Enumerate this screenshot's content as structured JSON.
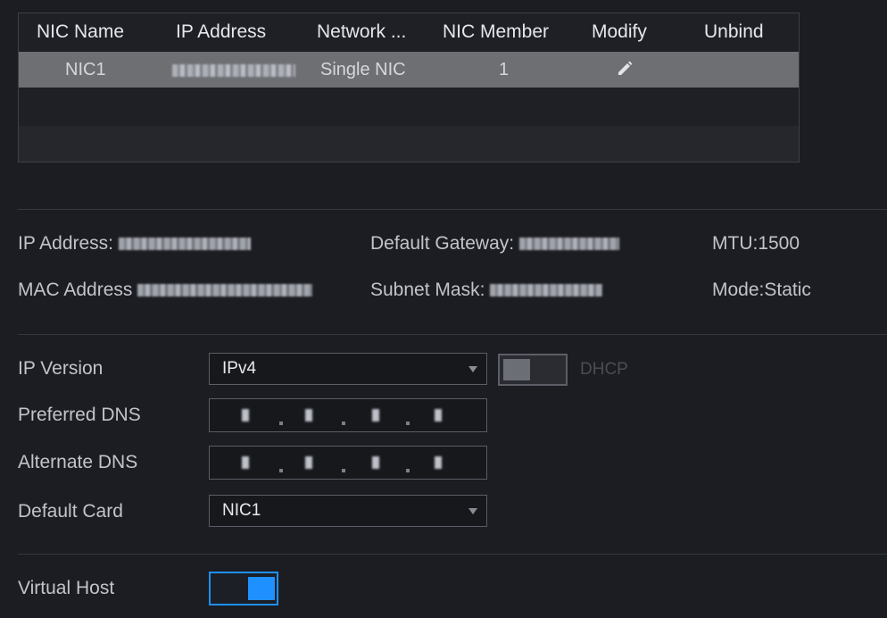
{
  "nic_table": {
    "columns": [
      "NIC Name",
      "IP Address",
      "Network ...",
      "NIC Member",
      "Modify",
      "Unbind"
    ],
    "rows": [
      {
        "nic_name": "NIC1",
        "network_mode": "Single NIC",
        "nic_member": "1"
      }
    ]
  },
  "info": {
    "ip_address_label": "IP Address:",
    "default_gateway_label": "Default Gateway:",
    "mtu": "MTU:1500",
    "mac_address_label": "MAC Address",
    "subnet_mask_label": "Subnet Mask:",
    "mode": "Mode:Static"
  },
  "form": {
    "ip_version_label": "IP Version",
    "ip_version_value": "IPv4",
    "dhcp_label": "DHCP",
    "dhcp_enabled": false,
    "preferred_dns_label": "Preferred DNS",
    "alternate_dns_label": "Alternate DNS",
    "default_card_label": "Default Card",
    "default_card_value": "NIC1",
    "virtual_host_label": "Virtual Host",
    "virtual_host_enabled": true
  },
  "icons": {
    "modify": "pencil-icon",
    "dropdown": "triangle-down-icon"
  },
  "colors": {
    "background": "#1b1d22",
    "selected_row": "#6e6f73",
    "accent": "#1e90ff"
  }
}
